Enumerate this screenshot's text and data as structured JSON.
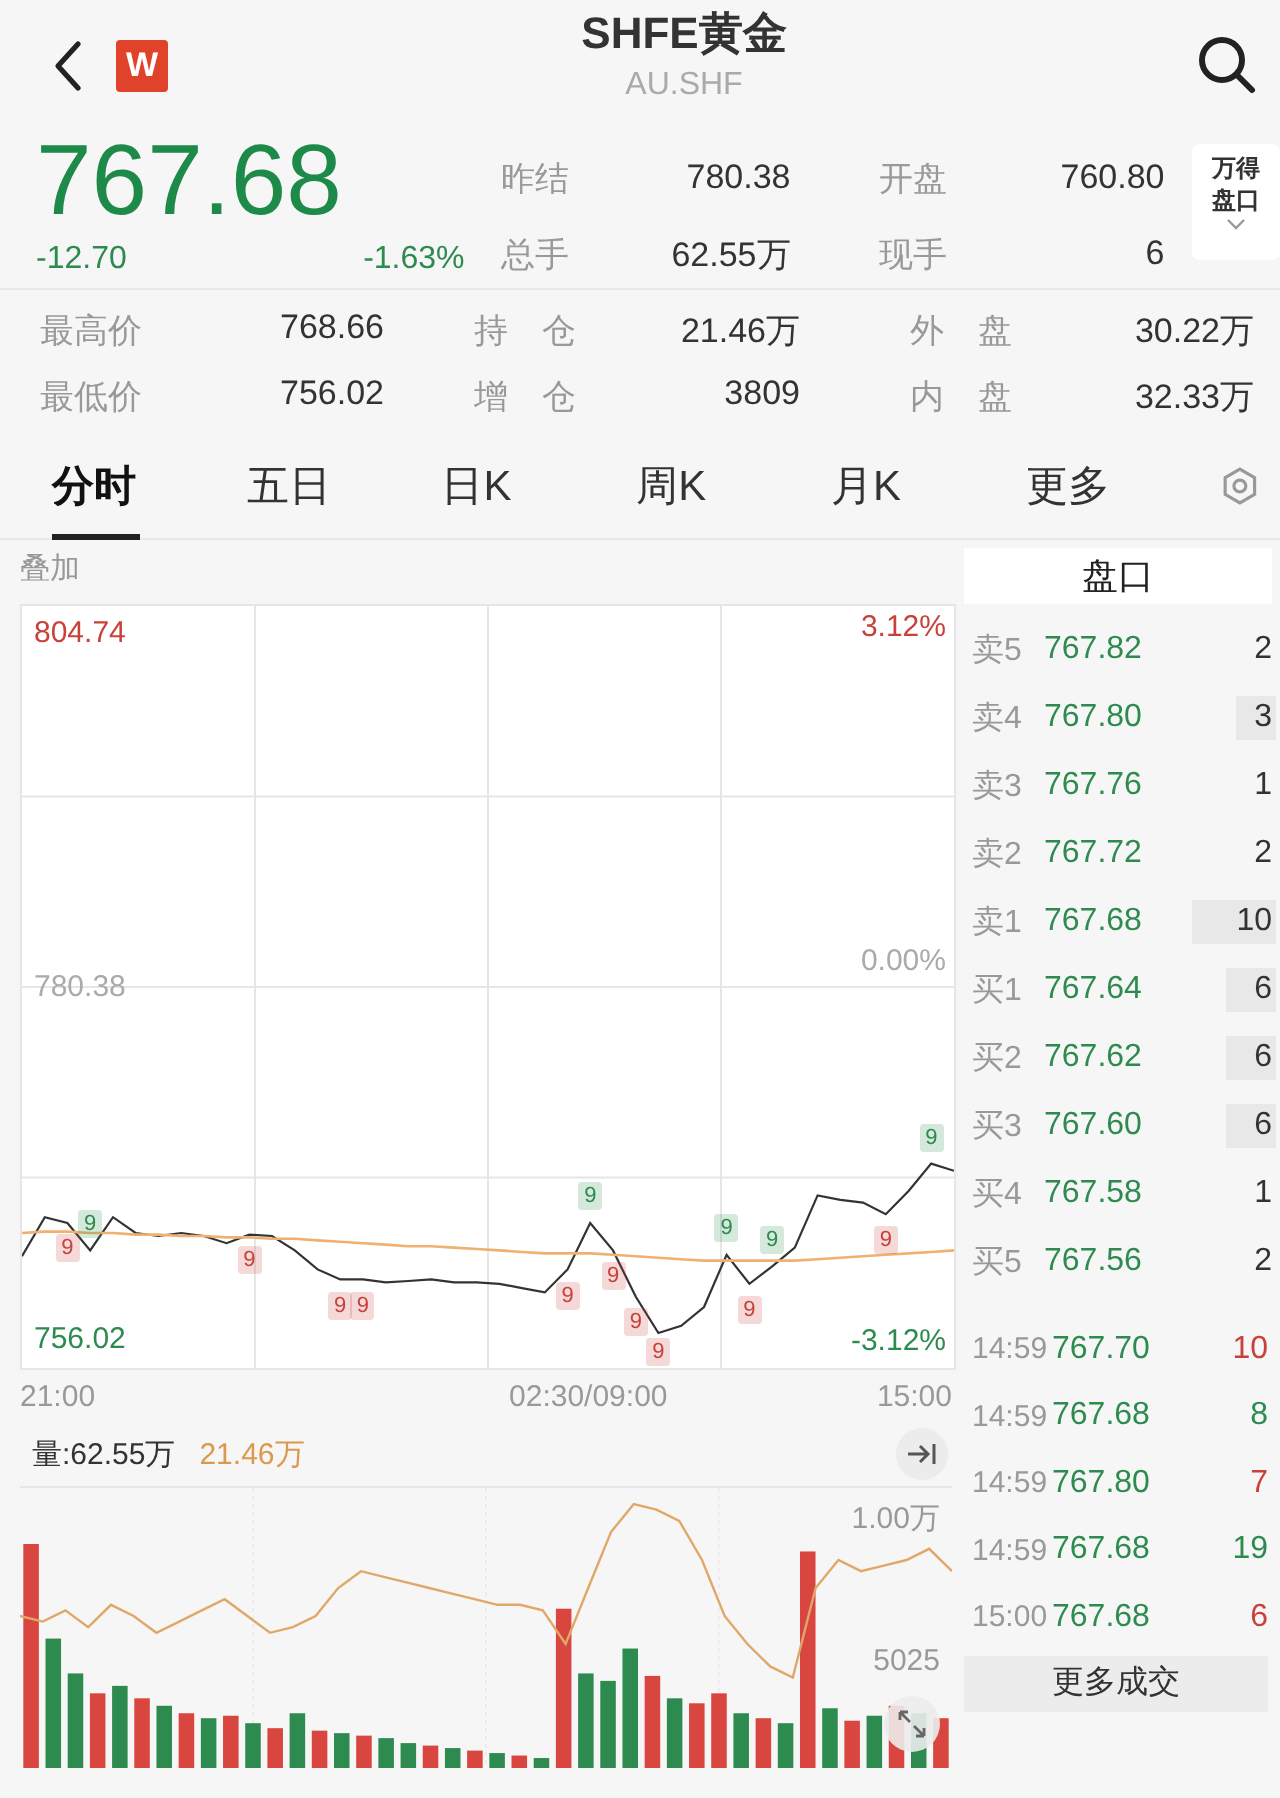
{
  "header": {
    "title": "SHFE黄金",
    "code": "AU.SHF",
    "logo": "W"
  },
  "quote": {
    "price": "767.68",
    "change": "-12.70",
    "change_pct": "-1.63%"
  },
  "stats_top": [
    {
      "label": "昨结",
      "value": "780.38"
    },
    {
      "label": "开盘",
      "value": "760.80"
    },
    {
      "label": "总手",
      "value": "62.55万"
    },
    {
      "label": "现手",
      "value": "6"
    }
  ],
  "wind_button": {
    "label": "万得盘口"
  },
  "stats_bottom": [
    {
      "label": "最高价",
      "value": "768.66"
    },
    {
      "label": "持　仓",
      "value": "21.46万"
    },
    {
      "label": "外　盘",
      "value": "30.22万"
    },
    {
      "label": "最低价",
      "value": "756.02"
    },
    {
      "label": "增　仓",
      "value": "3809"
    },
    {
      "label": "内　盘",
      "value": "32.33万"
    }
  ],
  "tabs": [
    {
      "label": "分时",
      "selected": true
    },
    {
      "label": "五日",
      "selected": false
    },
    {
      "label": "日K",
      "selected": false
    },
    {
      "label": "周K",
      "selected": false
    },
    {
      "label": "月K",
      "selected": false
    },
    {
      "label": "更多",
      "selected": false
    }
  ],
  "overlay_label": "叠加",
  "price_chart": {
    "pct_labels": [
      "3.12%",
      "0.00%",
      "-3.12%"
    ],
    "time_labels": [
      "21:00",
      "02:30/09:00",
      "15:00"
    ],
    "chart_data": {
      "type": "line",
      "series": [
        {
          "color": "#333333",
          "values": [
            761.8,
            764.5,
            764.1,
            762.2,
            764.5,
            763.4,
            763.2,
            763.4,
            763.2,
            762.7,
            763.3,
            763.2,
            762.2,
            760.9,
            760.2,
            760.2,
            760.0,
            760.1,
            760.2,
            760.0,
            760.0,
            759.9,
            759.6,
            759.3,
            760.9,
            764.1,
            762.2,
            759.0,
            756.5,
            757.0,
            758.3,
            761.9,
            759.9,
            761.1,
            762.4,
            766.0,
            765.7,
            765.5,
            764.7,
            766.3,
            768.2,
            767.7
          ]
        },
        {
          "color": "#f0b070",
          "values": [
            763.4,
            763.5,
            763.5,
            763.4,
            763.4,
            763.3,
            763.3,
            763.2,
            763.2,
            763.1,
            763.1,
            763.0,
            763.0,
            762.9,
            762.8,
            762.7,
            762.6,
            762.5,
            762.5,
            762.4,
            762.3,
            762.2,
            762.1,
            762.0,
            762.0,
            762.0,
            761.9,
            761.8,
            761.7,
            761.6,
            761.5,
            761.5,
            761.5,
            761.5,
            761.5,
            761.6,
            761.7,
            761.8,
            761.9,
            762.0,
            762.1,
            762.2
          ]
        }
      ],
      "ylim": [
        754.09,
        806.67
      ],
      "yticks": [
        {
          "value": 804.74,
          "label": "804.74"
        },
        {
          "value": 780.38,
          "label": "780.38"
        },
        {
          "value": 756.02,
          "label": "756.02"
        }
      ]
    },
    "markers": [
      {
        "label": "9",
        "color": "#2e8b4f"
      },
      {
        "label": "9",
        "color": "#c9413b"
      },
      {
        "label": "9",
        "color": "#c9413b"
      },
      {
        "label": "9",
        "color": "#c9413b"
      },
      {
        "label": "9",
        "color": "#c9413b"
      },
      {
        "label": "9",
        "color": "#c9413b"
      },
      {
        "label": "9",
        "color": "#2e8b4f"
      },
      {
        "label": "9",
        "color": "#c9413b"
      },
      {
        "label": "9",
        "color": "#c9413b"
      },
      {
        "label": "9",
        "color": "#c9413b"
      },
      {
        "label": "9",
        "color": "#2e8b4f"
      },
      {
        "label": "9",
        "color": "#c9413b"
      },
      {
        "label": "9",
        "color": "#2e8b4f"
      },
      {
        "label": "9",
        "color": "#c9413b"
      },
      {
        "label": "9",
        "color": "#2e8b4f"
      }
    ]
  },
  "volume_chart": {
    "volume_label": "量:62.55万",
    "oi_label": "21.46万",
    "axis_labels": [
      "1.00万",
      "5025"
    ],
    "kind": "picture"
  },
  "order_book": {
    "title": "盘口",
    "levels": [
      {
        "label": "卖5",
        "price": "767.82",
        "volume": "2"
      },
      {
        "label": "卖4",
        "price": "767.80",
        "volume": "3"
      },
      {
        "label": "卖3",
        "price": "767.76",
        "volume": "1"
      },
      {
        "label": "卖2",
        "price": "767.72",
        "volume": "2"
      },
      {
        "label": "卖1",
        "price": "767.68",
        "volume": "10"
      },
      {
        "label": "买1",
        "price": "767.64",
        "volume": "6"
      },
      {
        "label": "买2",
        "price": "767.62",
        "volume": "6"
      },
      {
        "label": "买3",
        "price": "767.60",
        "volume": "6"
      },
      {
        "label": "买4",
        "price": "767.58",
        "volume": "1"
      },
      {
        "label": "买5",
        "price": "767.56",
        "volume": "2"
      }
    ],
    "trades": [
      {
        "time": "14:59",
        "price": "767.70",
        "volume": "10",
        "color": "#c9413b"
      },
      {
        "time": "14:59",
        "price": "767.68",
        "volume": "8",
        "color": "#2e8b4f"
      },
      {
        "time": "14:59",
        "price": "767.80",
        "volume": "7",
        "color": "#c9413b"
      },
      {
        "time": "14:59",
        "price": "767.68",
        "volume": "19",
        "color": "#2e8b4f"
      },
      {
        "time": "15:00",
        "price": "767.68",
        "volume": "6",
        "color": "#c9413b"
      }
    ],
    "more_button": "更多成交"
  }
}
